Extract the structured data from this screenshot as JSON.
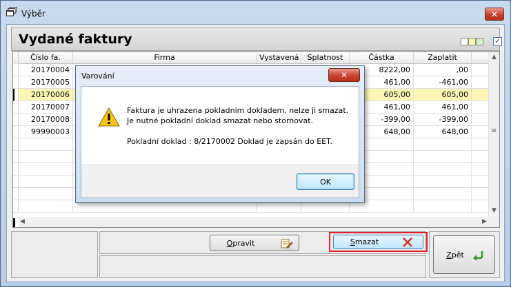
{
  "window": {
    "title": "Výběr",
    "close_glyph": "✕",
    "app_icon": "windows-stack-icon"
  },
  "header": {
    "title": "Vydané faktury",
    "swatch_colors": [
      "#ffffff",
      "#fff8b0",
      "#d8f0c8"
    ],
    "check": "✓"
  },
  "table": {
    "columns": [
      "Číslo fa.",
      "Firma",
      "Vystavená",
      "Splatnost",
      "Částka",
      "Zaplatit"
    ],
    "rows": [
      {
        "cislo": "20170004",
        "castka": "8222,00",
        "zaplatit": ",00"
      },
      {
        "cislo": "20170005",
        "castka": "461,00",
        "zaplatit": "-461,00"
      },
      {
        "cislo": "20170006",
        "castka": "605,00",
        "zaplatit": "605,00"
      },
      {
        "cislo": "20170007",
        "castka": "461,00",
        "zaplatit": "461,00"
      },
      {
        "cislo": "20170008",
        "castka": "-399,00",
        "zaplatit": "-399,00"
      },
      {
        "cislo": "99990003",
        "castka": "648,00",
        "zaplatit": "648,00"
      }
    ],
    "selected_row": 2,
    "selected_color": "#fbf6b4"
  },
  "buttons": {
    "opravit": {
      "label": "Opravit",
      "accel": "O",
      "rest": "pravit"
    },
    "smazat": {
      "label": "Smazat",
      "accel": "S",
      "rest": "mazat",
      "highlight_color": "#e0202a"
    },
    "zpet": {
      "label": "Zpět",
      "accel": "Z",
      "rest": "pět"
    }
  },
  "dialog": {
    "title": "Varování",
    "close_glyph": "✕",
    "line1": "Faktura je uhrazena pokladním dokladem, nelze ji smazat.",
    "line2": "Je nutné pokladní doklad smazat nebo stornovat.",
    "line3": "Pokladní doklad : 8/2170002 Doklad je zapsán do EET.",
    "ok_label": "OK",
    "icon": "warning-icon"
  }
}
